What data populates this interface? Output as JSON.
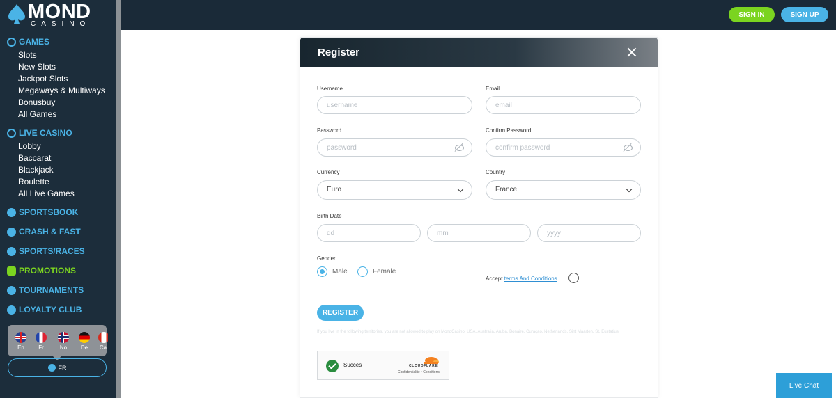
{
  "brand": {
    "name": "MOND",
    "sub": "CASINO"
  },
  "header": {
    "signin": "SIGN IN",
    "signup": "SIGN UP"
  },
  "sidebar": {
    "sections": [
      {
        "label": "GAMES",
        "icon": "games-icon",
        "items": [
          "Slots",
          "New Slots",
          "Jackpot Slots",
          "Megaways & Multiways",
          "Bonusbuy",
          "All Games"
        ]
      },
      {
        "label": "LIVE CASINO",
        "icon": "live-casino-icon",
        "items": [
          "Lobby",
          "Baccarat",
          "Blackjack",
          "Roulette",
          "All Live Games"
        ]
      },
      {
        "label": "SPORTSBOOK",
        "icon": "sportsbook-icon",
        "items": []
      },
      {
        "label": "CRASH & FAST",
        "icon": "rocket-icon",
        "items": []
      },
      {
        "label": "SPORTS/RACES",
        "icon": "races-icon",
        "items": []
      },
      {
        "label": "PROMOTIONS",
        "icon": "gift-icon",
        "items": []
      },
      {
        "label": "TOURNAMENTS",
        "icon": "trophy-icon",
        "items": []
      },
      {
        "label": "LOYALTY CLUB",
        "icon": "crown-icon",
        "items": []
      }
    ],
    "languages": [
      "En",
      "Fr",
      "No",
      "De",
      "Ca"
    ],
    "current_language": "FR"
  },
  "modal": {
    "title": "Register",
    "username": {
      "label": "Username",
      "placeholder": "username"
    },
    "email": {
      "label": "Email",
      "placeholder": "email"
    },
    "password": {
      "label": "Password",
      "placeholder": "password"
    },
    "confirm_password": {
      "label": "Confirm Password",
      "placeholder": "confirm password"
    },
    "currency": {
      "label": "Currency",
      "value": "Euro"
    },
    "country": {
      "label": "Country",
      "value": "France"
    },
    "birth_date": {
      "label": "Birth Date",
      "dd": "dd",
      "mm": "mm",
      "yyyy": "yyyy"
    },
    "gender": {
      "label": "Gender",
      "male": "Male",
      "female": "Female",
      "selected": "Male"
    },
    "accept": {
      "prefix": "Accept",
      "link": "terms And Conditions"
    },
    "register": "REGISTER",
    "notice": "If you live in the following territories, you are not allowed to play on MondCasino: USA, Australia, Aruba, Bonaire, Curaçao, Netherlands, Sint Maarten, St. Eustatius",
    "captcha": {
      "status": "Succès !",
      "brand": "CLOUDFLARE",
      "privacy": "Confidentialité",
      "terms": "Conditions"
    }
  },
  "live_chat": "Live Chat",
  "colors": {
    "accent": "#4ab3e6",
    "green": "#7bd420",
    "sidebar": "#1c2d3b",
    "header": "#1a2a38"
  }
}
